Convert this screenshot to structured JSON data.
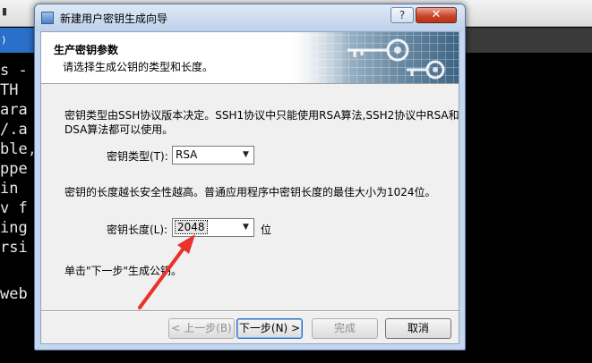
{
  "background": {
    "tab_label": ")",
    "terminal_lines": [
      "s -",
      "TH",
      "ara",
      "/.a",
      "ble,",
      "ppe",
      "in ",
      "v f",
      "ing",
      "rsi",
      "web"
    ]
  },
  "dialog": {
    "title": "新建用户密钥生成向导",
    "help_label": "?",
    "close_label": "✕",
    "header": {
      "title": "生产密钥参数",
      "subtitle": "请选择生成公钥的类型和长度。"
    },
    "description_line1": "密钥类型由SSH协议版本决定。SSH1协议中只能使用RSA算法,SSH2协议中RSA和",
    "description_line2": "DSA算法都可以使用。",
    "key_type": {
      "label": "密钥类型(T):",
      "value": "RSA"
    },
    "length_note": "密钥的长度越长安全性越高。普通应用程序中密钥长度的最佳大小为1024位。",
    "key_length": {
      "label": "密钥长度(L):",
      "value": "2048",
      "unit": "位"
    },
    "next_hint": "单击\"下一步\"生成公钥。",
    "buttons": {
      "back": "< 上一步(B)",
      "next": "下一步(N) >",
      "finish": "完成",
      "cancel": "取消"
    }
  },
  "colors": {
    "annotation_arrow": "#e8322a",
    "close_button": "#c9452a",
    "accent_blue": "#2f6cbf"
  },
  "icons": {
    "header_art": "keys-icon",
    "combo_arrow": "chevron-down-icon"
  }
}
